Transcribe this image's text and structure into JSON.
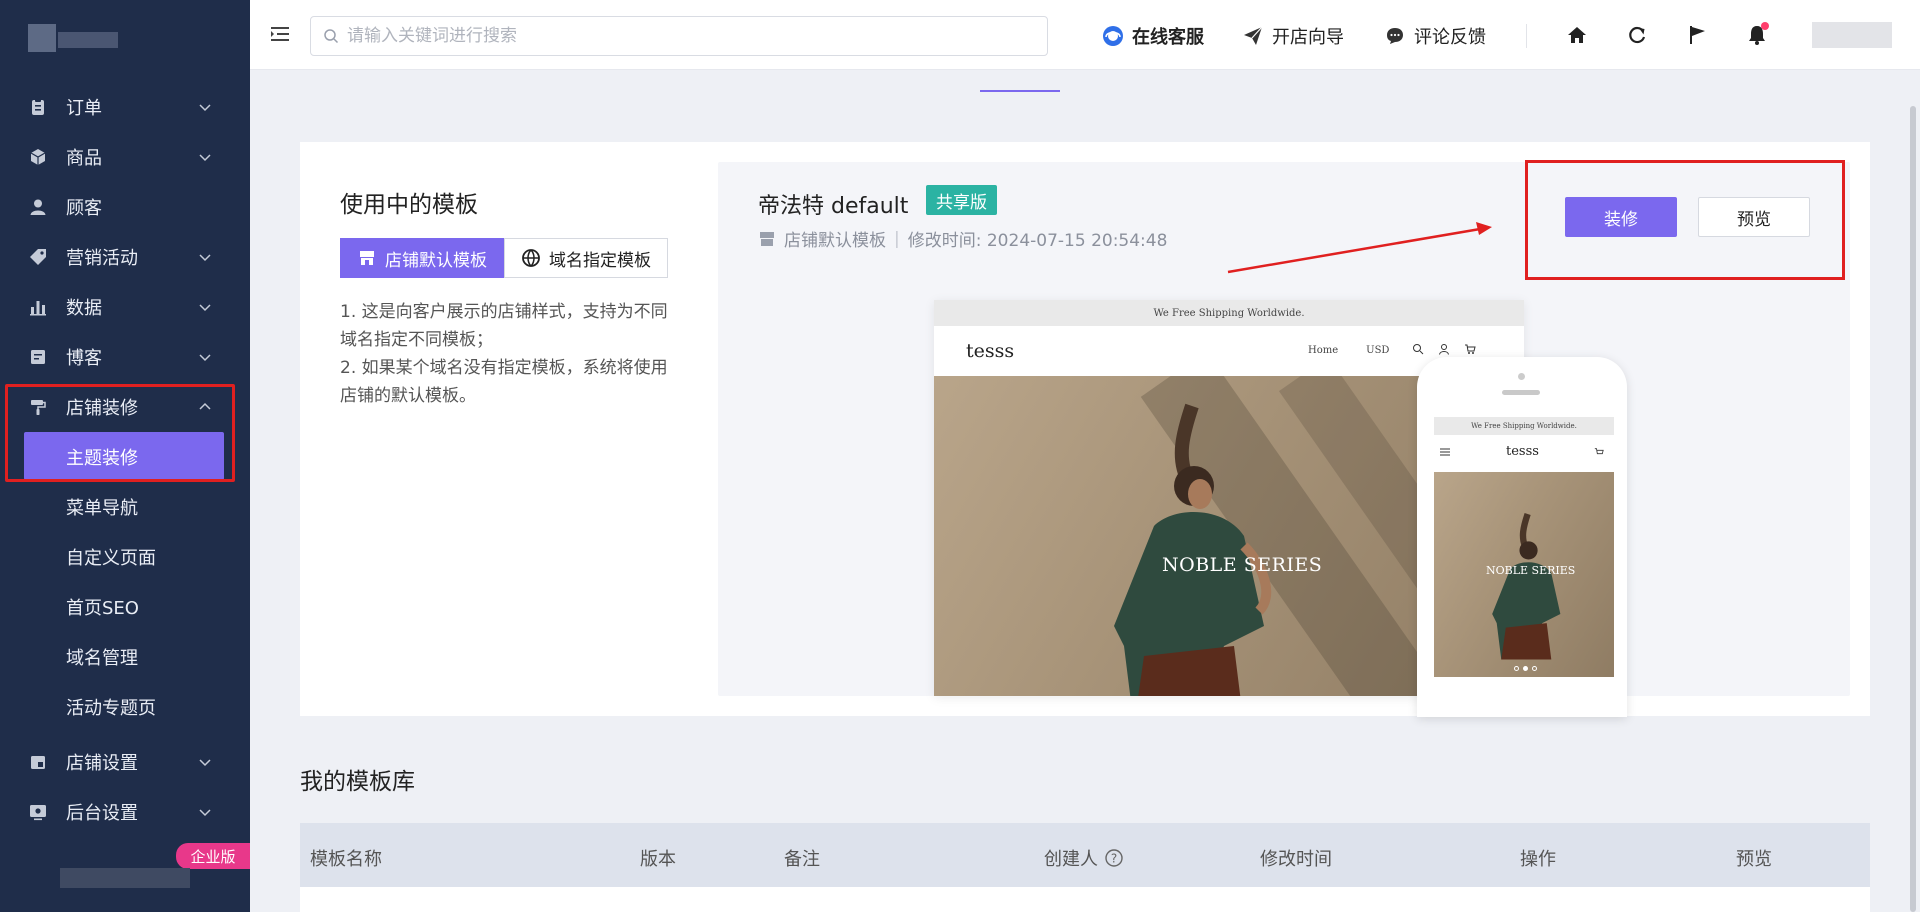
{
  "sidebar": {
    "items": [
      {
        "label": "订单",
        "icon": "clipboard-icon",
        "expandable": true
      },
      {
        "label": "商品",
        "icon": "cube-icon",
        "expandable": true
      },
      {
        "label": "顾客",
        "icon": "user-icon",
        "expandable": false
      },
      {
        "label": "营销活动",
        "icon": "tag-icon",
        "expandable": true
      },
      {
        "label": "数据",
        "icon": "bar-chart-icon",
        "expandable": true
      },
      {
        "label": "博客",
        "icon": "document-icon",
        "expandable": true
      },
      {
        "label": "店铺装修",
        "icon": "paint-roller-icon",
        "expandable": true,
        "expanded": true
      }
    ],
    "subitems": [
      "主题装修",
      "菜单导航",
      "自定义页面",
      "首页SEO",
      "域名管理",
      "活动专题页"
    ],
    "bottom_items": [
      {
        "label": "店铺设置",
        "icon": "store-icon"
      },
      {
        "label": "后台设置",
        "icon": "monitor-settings-icon"
      }
    ],
    "edition_badge": "企业版"
  },
  "header": {
    "search_placeholder": "请输入关键词进行搜索",
    "links": [
      {
        "label": "在线客服",
        "icon": "support-icon"
      },
      {
        "label": "开店向导",
        "icon": "paper-plane-icon"
      },
      {
        "label": "评论反馈",
        "icon": "chat-icon"
      }
    ]
  },
  "current_template": {
    "section_title": "使用中的模板",
    "tabs": [
      "店铺默认模板",
      "域名指定模板"
    ],
    "description_1": "1. 这是向客户展示的店铺样式，支持为不同域名指定不同模板；",
    "description_2": "2. 如果某个域名没有指定模板，系统将使用店铺的默认模板。",
    "name": "帝法特 default",
    "tag": "共享版",
    "meta_type": "店铺默认模板",
    "meta_modified": "修改时间: 2024-07-15 20:54:48",
    "decorate_button": "装修",
    "preview_button": "预览"
  },
  "preview_mock": {
    "shipping_banner": "We Free Shipping Worldwide.",
    "brand": "tesss",
    "nav_home": "Home",
    "currency": "USD",
    "hero_text": "NOBLE SERIES"
  },
  "library": {
    "title": "我的模板库",
    "columns": [
      "模板名称",
      "版本",
      "备注",
      "创建人",
      "修改时间",
      "操作",
      "预览"
    ]
  },
  "colors": {
    "accent": "#7b68ee",
    "sidebar_bg": "#1f2d4a",
    "tag_bg": "#2bb3a3",
    "highlight_red": "#e02020",
    "badge_pink": "#e8388a"
  }
}
